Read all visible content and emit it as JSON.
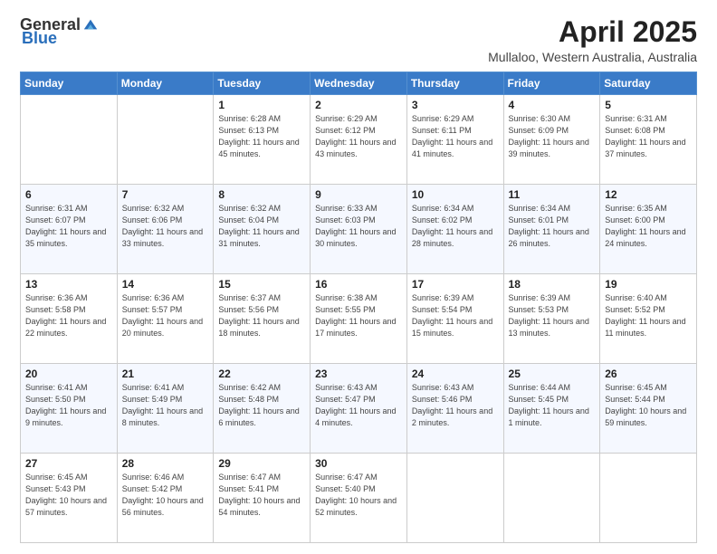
{
  "header": {
    "logo_general": "General",
    "logo_blue": "Blue",
    "month_title": "April 2025",
    "location": "Mullaloo, Western Australia, Australia"
  },
  "weekdays": [
    "Sunday",
    "Monday",
    "Tuesday",
    "Wednesday",
    "Thursday",
    "Friday",
    "Saturday"
  ],
  "weeks": [
    [
      {
        "day": "",
        "sunrise": "",
        "sunset": "",
        "daylight": ""
      },
      {
        "day": "",
        "sunrise": "",
        "sunset": "",
        "daylight": ""
      },
      {
        "day": "1",
        "sunrise": "Sunrise: 6:28 AM",
        "sunset": "Sunset: 6:13 PM",
        "daylight": "Daylight: 11 hours and 45 minutes."
      },
      {
        "day": "2",
        "sunrise": "Sunrise: 6:29 AM",
        "sunset": "Sunset: 6:12 PM",
        "daylight": "Daylight: 11 hours and 43 minutes."
      },
      {
        "day": "3",
        "sunrise": "Sunrise: 6:29 AM",
        "sunset": "Sunset: 6:11 PM",
        "daylight": "Daylight: 11 hours and 41 minutes."
      },
      {
        "day": "4",
        "sunrise": "Sunrise: 6:30 AM",
        "sunset": "Sunset: 6:09 PM",
        "daylight": "Daylight: 11 hours and 39 minutes."
      },
      {
        "day": "5",
        "sunrise": "Sunrise: 6:31 AM",
        "sunset": "Sunset: 6:08 PM",
        "daylight": "Daylight: 11 hours and 37 minutes."
      }
    ],
    [
      {
        "day": "6",
        "sunrise": "Sunrise: 6:31 AM",
        "sunset": "Sunset: 6:07 PM",
        "daylight": "Daylight: 11 hours and 35 minutes."
      },
      {
        "day": "7",
        "sunrise": "Sunrise: 6:32 AM",
        "sunset": "Sunset: 6:06 PM",
        "daylight": "Daylight: 11 hours and 33 minutes."
      },
      {
        "day": "8",
        "sunrise": "Sunrise: 6:32 AM",
        "sunset": "Sunset: 6:04 PM",
        "daylight": "Daylight: 11 hours and 31 minutes."
      },
      {
        "day": "9",
        "sunrise": "Sunrise: 6:33 AM",
        "sunset": "Sunset: 6:03 PM",
        "daylight": "Daylight: 11 hours and 30 minutes."
      },
      {
        "day": "10",
        "sunrise": "Sunrise: 6:34 AM",
        "sunset": "Sunset: 6:02 PM",
        "daylight": "Daylight: 11 hours and 28 minutes."
      },
      {
        "day": "11",
        "sunrise": "Sunrise: 6:34 AM",
        "sunset": "Sunset: 6:01 PM",
        "daylight": "Daylight: 11 hours and 26 minutes."
      },
      {
        "day": "12",
        "sunrise": "Sunrise: 6:35 AM",
        "sunset": "Sunset: 6:00 PM",
        "daylight": "Daylight: 11 hours and 24 minutes."
      }
    ],
    [
      {
        "day": "13",
        "sunrise": "Sunrise: 6:36 AM",
        "sunset": "Sunset: 5:58 PM",
        "daylight": "Daylight: 11 hours and 22 minutes."
      },
      {
        "day": "14",
        "sunrise": "Sunrise: 6:36 AM",
        "sunset": "Sunset: 5:57 PM",
        "daylight": "Daylight: 11 hours and 20 minutes."
      },
      {
        "day": "15",
        "sunrise": "Sunrise: 6:37 AM",
        "sunset": "Sunset: 5:56 PM",
        "daylight": "Daylight: 11 hours and 18 minutes."
      },
      {
        "day": "16",
        "sunrise": "Sunrise: 6:38 AM",
        "sunset": "Sunset: 5:55 PM",
        "daylight": "Daylight: 11 hours and 17 minutes."
      },
      {
        "day": "17",
        "sunrise": "Sunrise: 6:39 AM",
        "sunset": "Sunset: 5:54 PM",
        "daylight": "Daylight: 11 hours and 15 minutes."
      },
      {
        "day": "18",
        "sunrise": "Sunrise: 6:39 AM",
        "sunset": "Sunset: 5:53 PM",
        "daylight": "Daylight: 11 hours and 13 minutes."
      },
      {
        "day": "19",
        "sunrise": "Sunrise: 6:40 AM",
        "sunset": "Sunset: 5:52 PM",
        "daylight": "Daylight: 11 hours and 11 minutes."
      }
    ],
    [
      {
        "day": "20",
        "sunrise": "Sunrise: 6:41 AM",
        "sunset": "Sunset: 5:50 PM",
        "daylight": "Daylight: 11 hours and 9 minutes."
      },
      {
        "day": "21",
        "sunrise": "Sunrise: 6:41 AM",
        "sunset": "Sunset: 5:49 PM",
        "daylight": "Daylight: 11 hours and 8 minutes."
      },
      {
        "day": "22",
        "sunrise": "Sunrise: 6:42 AM",
        "sunset": "Sunset: 5:48 PM",
        "daylight": "Daylight: 11 hours and 6 minutes."
      },
      {
        "day": "23",
        "sunrise": "Sunrise: 6:43 AM",
        "sunset": "Sunset: 5:47 PM",
        "daylight": "Daylight: 11 hours and 4 minutes."
      },
      {
        "day": "24",
        "sunrise": "Sunrise: 6:43 AM",
        "sunset": "Sunset: 5:46 PM",
        "daylight": "Daylight: 11 hours and 2 minutes."
      },
      {
        "day": "25",
        "sunrise": "Sunrise: 6:44 AM",
        "sunset": "Sunset: 5:45 PM",
        "daylight": "Daylight: 11 hours and 1 minute."
      },
      {
        "day": "26",
        "sunrise": "Sunrise: 6:45 AM",
        "sunset": "Sunset: 5:44 PM",
        "daylight": "Daylight: 10 hours and 59 minutes."
      }
    ],
    [
      {
        "day": "27",
        "sunrise": "Sunrise: 6:45 AM",
        "sunset": "Sunset: 5:43 PM",
        "daylight": "Daylight: 10 hours and 57 minutes."
      },
      {
        "day": "28",
        "sunrise": "Sunrise: 6:46 AM",
        "sunset": "Sunset: 5:42 PM",
        "daylight": "Daylight: 10 hours and 56 minutes."
      },
      {
        "day": "29",
        "sunrise": "Sunrise: 6:47 AM",
        "sunset": "Sunset: 5:41 PM",
        "daylight": "Daylight: 10 hours and 54 minutes."
      },
      {
        "day": "30",
        "sunrise": "Sunrise: 6:47 AM",
        "sunset": "Sunset: 5:40 PM",
        "daylight": "Daylight: 10 hours and 52 minutes."
      },
      {
        "day": "",
        "sunrise": "",
        "sunset": "",
        "daylight": ""
      },
      {
        "day": "",
        "sunrise": "",
        "sunset": "",
        "daylight": ""
      },
      {
        "day": "",
        "sunrise": "",
        "sunset": "",
        "daylight": ""
      }
    ]
  ]
}
